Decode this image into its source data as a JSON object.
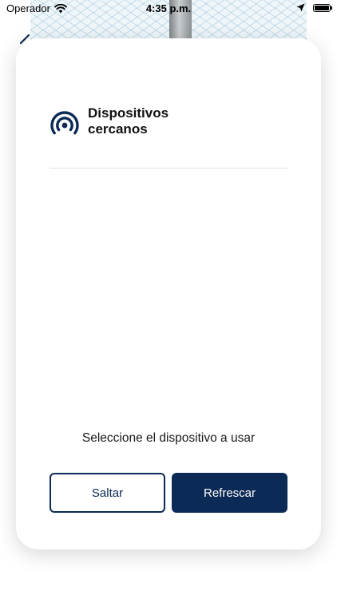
{
  "status_bar": {
    "carrier": "Operador",
    "time": "4:35 p.m.",
    "icons": [
      "wifi-icon",
      "location-arrow-icon",
      "battery-icon"
    ]
  },
  "header": {
    "icon": "signal-broadcast-icon",
    "title": "Dispositivos cercanos"
  },
  "main": {
    "instruction": "Seleccione el dispositivo a usar"
  },
  "actions": {
    "skip_label": "Saltar",
    "refresh_label": "Refrescar"
  },
  "colors": {
    "primary": "#0b2a55",
    "background": "#ffffff",
    "divider": "#e3e3e3"
  }
}
